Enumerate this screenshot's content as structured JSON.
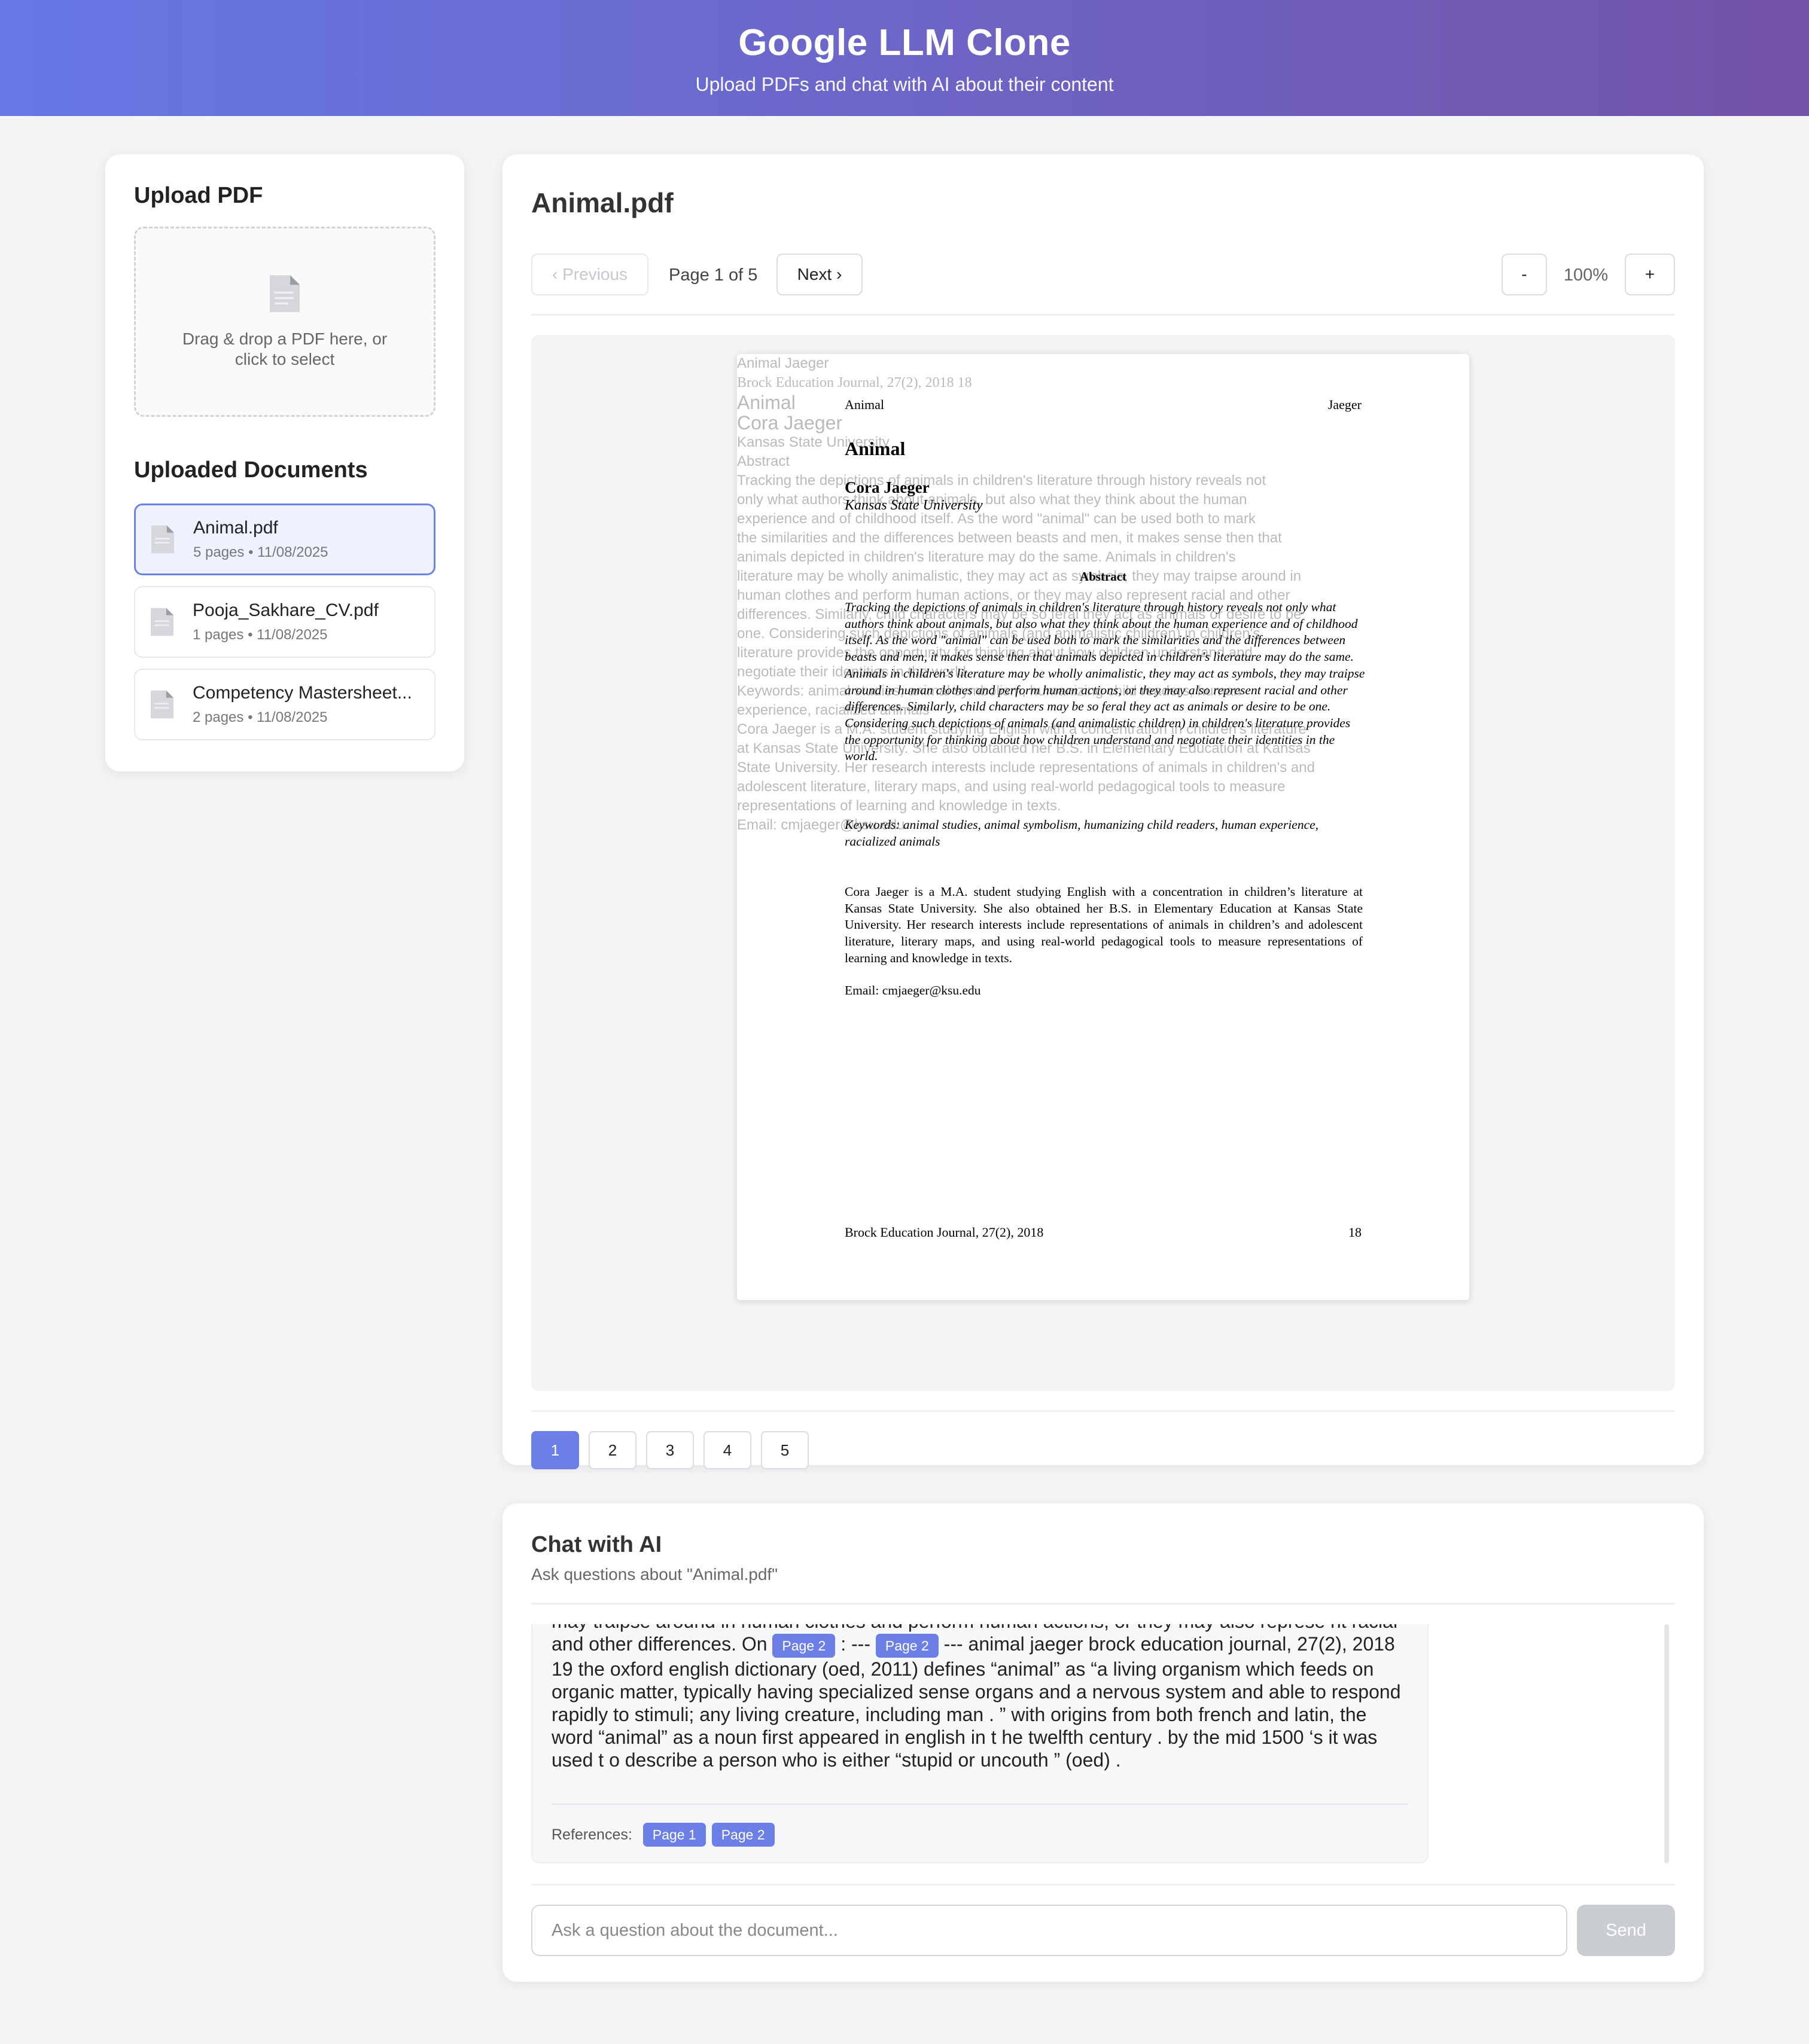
{
  "header": {
    "title": "Google LLM Clone",
    "subtitle": "Upload PDFs and chat with AI about their content"
  },
  "sidebar": {
    "upload_heading": "Upload PDF",
    "dropzone_text": "Drag & drop a PDF here, or click to select",
    "docs_heading": "Uploaded Documents",
    "documents": [
      {
        "name": "Animal.pdf",
        "meta": "5 pages • 11/08/2025",
        "active": true
      },
      {
        "name": "Pooja_Sakhare_CV.pdf",
        "meta": "1 pages • 11/08/2025",
        "active": false
      },
      {
        "name": "Competency Mastersheet...",
        "meta": "2 pages • 11/08/2025",
        "active": false
      }
    ]
  },
  "viewer": {
    "title": "Animal.pdf",
    "prev_label": "‹ Previous",
    "page_info": "Page 1 of 5",
    "next_label": "Next ›",
    "zoom_out_label": "-",
    "zoom_value": "100%",
    "zoom_in_label": "+",
    "page_numbers": [
      "1",
      "2",
      "3",
      "4",
      "5"
    ],
    "current_page": "1",
    "text_layer": [
      "Animal Jaeger",
      "Brock Education Journal, 27(2), 2018 18",
      "Animal",
      "Cora Jaeger",
      "Kansas State University",
      "Abstract",
      "Tracking the depictions of animals in children's literature through history reveals not",
      "only what authors think about animals, but also what they think about the human",
      "experience and of childhood itself. As the word \"animal\" can be used both to mark",
      "the similarities and the differences between beasts and men, it makes sense then that",
      "animals depicted in children's literature may do the same. Animals in children's",
      "literature may be wholly animalistic, they may act as symbols, they may traipse around in",
      "human clothes and perform human actions, or they may also represent racial and other",
      "differences. Similarly, child characters may be so feral they act as animals or desire to be",
      "one. Considering such depictions of animals (and animalistic children) in children's",
      "literature provides the opportunity for thinking about how children understand and",
      "negotiate their identities in the world.",
      "Keywords: animal studies, animal symbolism, humanizing child readers, human",
      "experience, racialized animals",
      "Cora Jaeger is a M.A. student studying English with a concentration in children's literature",
      "at Kansas State University. She also obtained her B.S. in Elementary Education at Kansas",
      "State University. Her research interests include representations of animals in children's and",
      "adolescent literature, literary maps, and using real-world pedagogical tools to measure",
      "representations of learning and knowledge in texts.",
      "Email: cmjaeger@ksu.edu"
    ],
    "page": {
      "header_left": "Animal",
      "header_right": "Jaeger",
      "title": "Animal",
      "author": "Cora Jaeger",
      "institution": "Kansas State University",
      "abstract_heading": "Abstract",
      "abstract": "Tracking the depictions of animals in children's literature through history reveals not only what authors think about animals, but also what they think about the human experience and of childhood itself. As the word \"animal\" can be used both to mark the similarities and the differences between beasts and men, it makes sense then that animals depicted in children's literature may do the same. Animals in children's literature may be wholly animalistic, they may act as symbols, they may traipse around in human clothes and perform human actions, or they may also represent racial and other differences. Similarly, child characters may be so feral they act as animals or desire to be one. Considering such depictions of animals (and animalistic children) in children's literature provides the opportunity for thinking about how children understand and negotiate their identities in the world.",
      "keywords": "Keywords:  animal studies, animal symbolism, humanizing child readers, human experience, racialized animals",
      "bio": "Cora Jaeger is a M.A. student studying English with a concentration in children’s literature at Kansas State University. She also obtained her B.S. in Elementary Education at Kansas State University. Her research interests include representations of animals in children’s and adolescent literature, literary maps, and using real-world pedagogical tools to measure representations of learning and knowledge in texts.",
      "email": "Email: cmjaeger@ksu.edu",
      "footer_left": "Brock Education Journal, 27(2), 2018",
      "footer_right": "18"
    }
  },
  "chat": {
    "heading": "Chat with AI",
    "subtitle": "Ask questions about \"Animal.pdf\"",
    "answer_part1": "may traipse around in human clothes and perform human actions, or they may also represe nt racial and other differences. On ",
    "tag_a": "Page 2",
    "answer_part2": " : --- ",
    "tag_b": "Page 2",
    "answer_part3": " --- animal jaeger brock education journal, 27(2), 2018 19 the oxford english dictionary (oed, 2011) defines “animal” as “a living organism which feeds on organic matter, typically having specialized sense organs and a nervous system and able to respond rapidly to stimuli; any living creature, including man . ” with origins from both french and latin, the word “animal” as a noun first appeared in english in t he twelfth century . by the mid 1500 ‘s it was used t o describe a person who is either “stupid or uncouth ” (oed) .",
    "references_label": "References:",
    "references": [
      "Page 1",
      "Page 2"
    ],
    "input_placeholder": "Ask a question about the document...",
    "send_label": "Send"
  },
  "colors": {
    "header_gradient_start": "#6678e6",
    "header_gradient_end": "#7353a8",
    "accent": "#6b7fe6",
    "active_doc_bg": "#eef1fe"
  }
}
